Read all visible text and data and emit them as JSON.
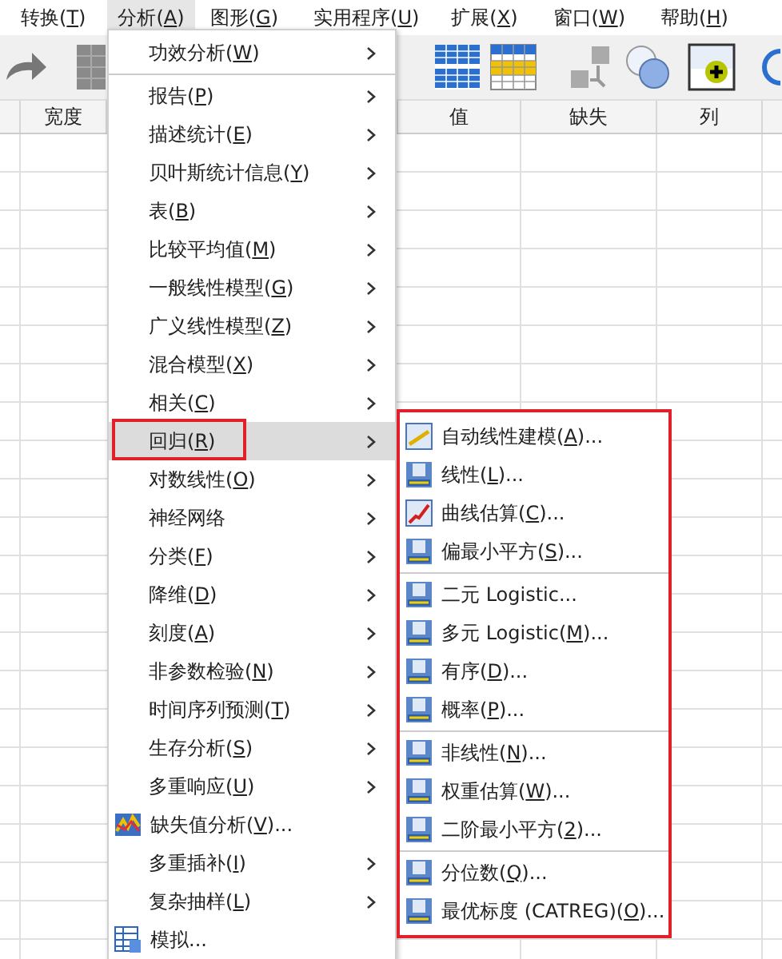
{
  "menubar": [
    {
      "before": "转换(",
      "key": "T",
      "after": ")",
      "selected": false
    },
    {
      "before": "分析(",
      "key": "A",
      "after": ")",
      "selected": true
    },
    {
      "before": "图形(",
      "key": "G",
      "after": ")",
      "selected": false
    },
    {
      "before": "实用程序(",
      "key": "U",
      "after": ")",
      "selected": false
    },
    {
      "before": "扩展(",
      "key": "X",
      "after": ")",
      "selected": false
    },
    {
      "before": "窗口(",
      "key": "W",
      "after": ")",
      "selected": false
    },
    {
      "before": "帮助(",
      "key": "H",
      "after": ")",
      "selected": false
    }
  ],
  "grid_columns": [
    {
      "label": "宽度"
    },
    {
      "label": "值"
    },
    {
      "label": "缺失"
    },
    {
      "label": "列"
    }
  ],
  "analyze_menu": [
    {
      "kind": "plain",
      "before": "功效分析(",
      "key": "W",
      "after": ")",
      "submenu": true,
      "separator_after": true,
      "selected": false
    },
    {
      "kind": "plain",
      "before": "报告(",
      "key": "P",
      "after": ")",
      "submenu": true,
      "selected": false
    },
    {
      "kind": "plain",
      "before": "描述统计(",
      "key": "E",
      "after": ")",
      "submenu": true,
      "selected": false
    },
    {
      "kind": "plain",
      "before": "贝叶斯统计信息(",
      "key": "Y",
      "after": ")",
      "submenu": true,
      "selected": false
    },
    {
      "kind": "plain",
      "before": "表(",
      "key": "B",
      "after": ")",
      "submenu": true,
      "selected": false
    },
    {
      "kind": "plain",
      "before": "比较平均值(",
      "key": "M",
      "after": ")",
      "submenu": true,
      "selected": false
    },
    {
      "kind": "plain",
      "before": "一般线性模型(",
      "key": "G",
      "after": ")",
      "submenu": true,
      "selected": false
    },
    {
      "kind": "plain",
      "before": "广义线性模型(",
      "key": "Z",
      "after": ")",
      "submenu": true,
      "selected": false
    },
    {
      "kind": "plain",
      "before": "混合模型(",
      "key": "X",
      "after": ")",
      "submenu": true,
      "selected": false
    },
    {
      "kind": "plain",
      "before": "相关(",
      "key": "C",
      "after": ")",
      "submenu": true,
      "selected": false
    },
    {
      "kind": "plain",
      "before": "回归(",
      "key": "R",
      "after": ")",
      "submenu": true,
      "selected": true
    },
    {
      "kind": "plain",
      "before": "对数线性(",
      "key": "O",
      "after": ")",
      "submenu": true,
      "selected": false
    },
    {
      "kind": "plain",
      "before": "神经网络",
      "submenu": true,
      "selected": false
    },
    {
      "kind": "plain",
      "before": "分类(",
      "key": "F",
      "after": ")",
      "submenu": true,
      "selected": false
    },
    {
      "kind": "plain",
      "before": "降维(",
      "key": "D",
      "after": ")",
      "submenu": true,
      "selected": false
    },
    {
      "kind": "plain",
      "before": "刻度(",
      "key": "A",
      "after": ")",
      "submenu": true,
      "selected": false
    },
    {
      "kind": "plain",
      "before": "非参数检验(",
      "key": "N",
      "after": ")",
      "submenu": true,
      "selected": false
    },
    {
      "kind": "plain",
      "before": "时间序列预测(",
      "key": "T",
      "after": ")",
      "submenu": true,
      "selected": false
    },
    {
      "kind": "plain",
      "before": "生存分析(",
      "key": "S",
      "after": ")",
      "submenu": true,
      "selected": false
    },
    {
      "kind": "plain",
      "before": "多重响应(",
      "key": "U",
      "after": ")",
      "submenu": true,
      "selected": false
    },
    {
      "kind": "chart",
      "before": "缺失值分析(",
      "key": "V",
      "after": ")...",
      "submenu": false,
      "selected": false
    },
    {
      "kind": "plain",
      "before": "多重插补(",
      "key": "I",
      "after": ")",
      "submenu": true,
      "selected": false
    },
    {
      "kind": "plain",
      "before": "复杂抽样(",
      "key": "L",
      "after": ")",
      "submenu": true,
      "selected": false
    },
    {
      "kind": "table",
      "before": "模拟...",
      "submenu": false,
      "selected": false
    }
  ],
  "regression_menu": [
    {
      "kind": "auto",
      "before": "自动线性建模(",
      "key": "A",
      "after": ")..."
    },
    {
      "kind": "r",
      "before": "线性(",
      "key": "L",
      "after": ")..."
    },
    {
      "kind": "curve",
      "before": "曲线估算(",
      "key": "C",
      "after": ")..."
    },
    {
      "kind": "r",
      "before": "偏最小平方(",
      "key": "S",
      "after": ")...",
      "separator_after": true
    },
    {
      "kind": "r",
      "before": "二元 Logistic..."
    },
    {
      "kind": "r",
      "before": "多元 Logistic(",
      "key": "M",
      "after": ")..."
    },
    {
      "kind": "r",
      "before": "有序(",
      "key": "D",
      "after": ")..."
    },
    {
      "kind": "r",
      "before": "概率(",
      "key": "P",
      "after": ")...",
      "separator_after": true
    },
    {
      "kind": "r",
      "before": "非线性(",
      "key": "N",
      "after": ")..."
    },
    {
      "kind": "r",
      "before": "权重估算(",
      "key": "W",
      "after": ")..."
    },
    {
      "kind": "r",
      "before": "二阶最小平方(",
      "key": "2",
      "after": ")...",
      "separator_after": true
    },
    {
      "kind": "r",
      "before": "分位数(",
      "key": "Q",
      "after": ")..."
    },
    {
      "kind": "r",
      "before": "最优标度 (CATREG)(",
      "key": "O",
      "after": ")..."
    }
  ]
}
